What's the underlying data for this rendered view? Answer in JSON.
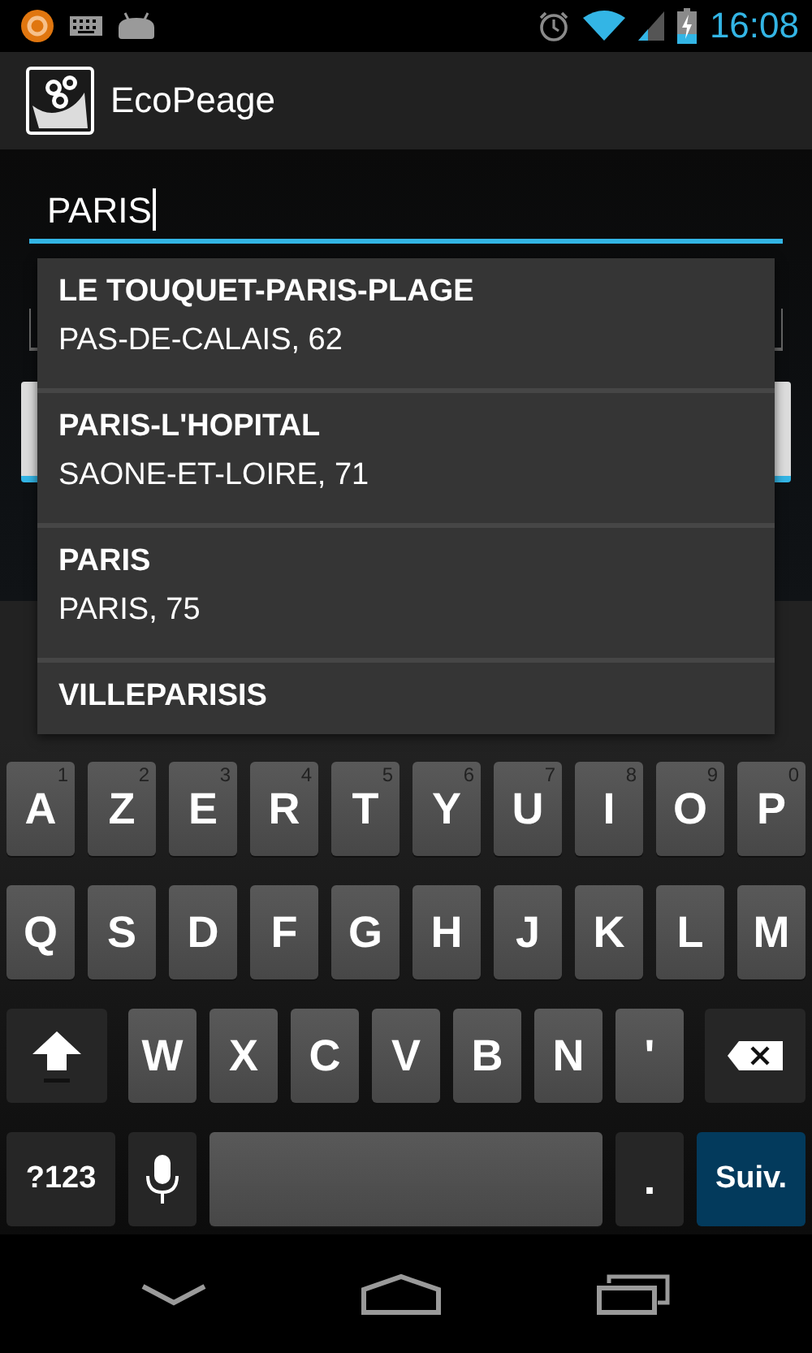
{
  "status_bar": {
    "time": "16:08"
  },
  "action_bar": {
    "title": "EcoPeage"
  },
  "search": {
    "value": "PARIS"
  },
  "suggestions": [
    {
      "name": "LE TOUQUET-PARIS-PLAGE",
      "detail": "PAS-DE-CALAIS, 62"
    },
    {
      "name": "PARIS-L'HOPITAL",
      "detail": "SAONE-ET-LOIRE, 71"
    },
    {
      "name": "PARIS",
      "detail": "PARIS, 75"
    },
    {
      "name": "VILLEPARISIS"
    }
  ],
  "keyboard": {
    "rows": [
      {
        "keys": [
          {
            "kind": "letter",
            "label": "A",
            "hint": "1"
          },
          {
            "kind": "letter",
            "label": "Z",
            "hint": "2"
          },
          {
            "kind": "letter",
            "label": "E",
            "hint": "3"
          },
          {
            "kind": "letter",
            "label": "R",
            "hint": "4"
          },
          {
            "kind": "letter",
            "label": "T",
            "hint": "5"
          },
          {
            "kind": "letter",
            "label": "Y",
            "hint": "6"
          },
          {
            "kind": "letter",
            "label": "U",
            "hint": "7"
          },
          {
            "kind": "letter",
            "label": "I",
            "hint": "8"
          },
          {
            "kind": "letter",
            "label": "O",
            "hint": "9"
          },
          {
            "kind": "letter",
            "label": "P",
            "hint": "0"
          }
        ]
      },
      {
        "keys": [
          {
            "kind": "letter",
            "label": "Q"
          },
          {
            "kind": "letter",
            "label": "S"
          },
          {
            "kind": "letter",
            "label": "D"
          },
          {
            "kind": "letter",
            "label": "F"
          },
          {
            "kind": "letter",
            "label": "G"
          },
          {
            "kind": "letter",
            "label": "H"
          },
          {
            "kind": "letter",
            "label": "J"
          },
          {
            "kind": "letter",
            "label": "K"
          },
          {
            "kind": "letter",
            "label": "L"
          },
          {
            "kind": "letter",
            "label": "M"
          }
        ]
      },
      {
        "keys": [
          {
            "kind": "shift"
          },
          {
            "kind": "letter",
            "label": "W"
          },
          {
            "kind": "letter",
            "label": "X"
          },
          {
            "kind": "letter",
            "label": "C"
          },
          {
            "kind": "letter",
            "label": "V"
          },
          {
            "kind": "letter",
            "label": "B"
          },
          {
            "kind": "letter",
            "label": "N"
          },
          {
            "kind": "letter",
            "label": "'"
          },
          {
            "kind": "delete"
          }
        ]
      },
      {
        "keys": [
          {
            "kind": "symbols",
            "label": "?123"
          },
          {
            "kind": "mic"
          },
          {
            "kind": "space"
          },
          {
            "kind": "punct",
            "label": "."
          },
          {
            "kind": "action",
            "label": "Suiv."
          }
        ]
      }
    ]
  }
}
